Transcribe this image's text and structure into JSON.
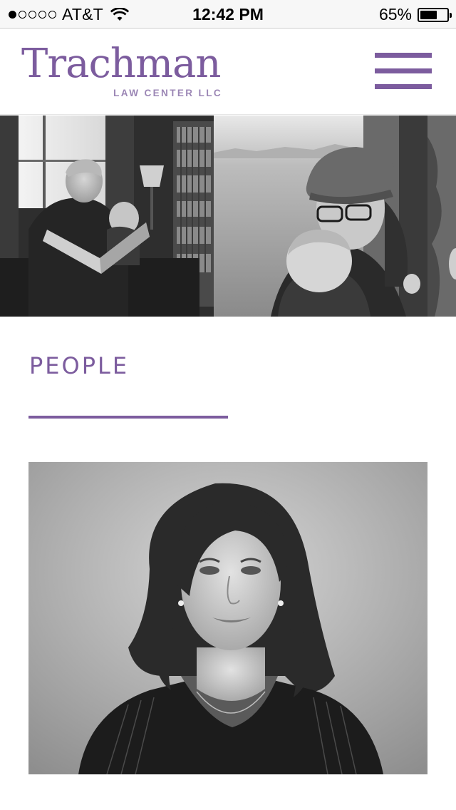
{
  "status_bar": {
    "carrier": "AT&T",
    "time": "12:42 PM",
    "battery_percent": "65%",
    "battery_level": 0.65,
    "signal_bars": 1,
    "signal_total": 5
  },
  "header": {
    "logo_name": "Trachman",
    "logo_subtitle": "LAW CENTER LLC",
    "accent_color": "#7c5c9e"
  },
  "hero": {
    "photos": [
      "father-reading-to-baby-photo",
      "mother-with-baby-photo",
      "outdoor-photo-partial"
    ]
  },
  "people": {
    "heading": "PEOPLE",
    "portrait": "attorney-portrait-photo"
  }
}
